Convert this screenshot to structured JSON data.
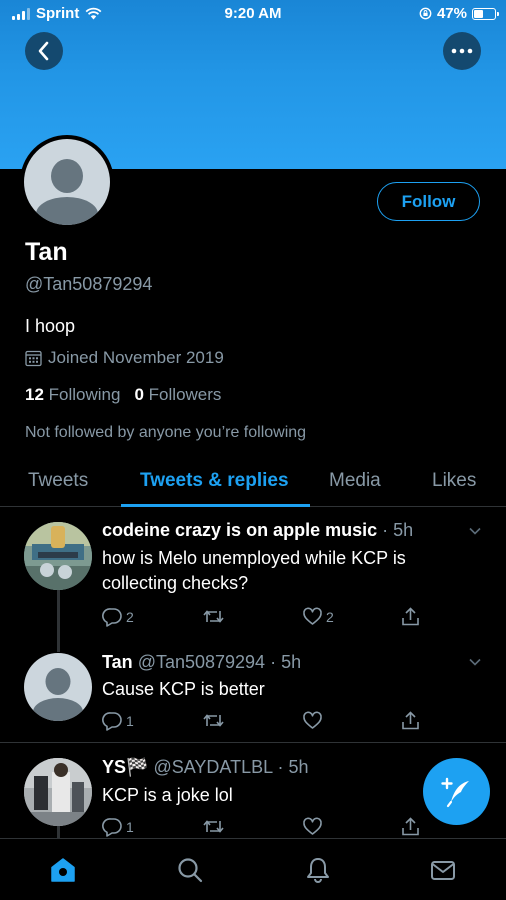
{
  "status_bar": {
    "carrier": "Sprint",
    "time": "9:20 AM",
    "battery": "47%",
    "battery_level": 0.47
  },
  "header": {
    "back_icon": "chevron-left-icon",
    "more_icon": "more-horizontal-icon"
  },
  "profile": {
    "name": "Tan",
    "handle": "@Tan50879294",
    "bio": "I hoop",
    "joined": "Joined November 2019",
    "following_count": "12",
    "following_label": "Following",
    "followers_count": "0",
    "followers_label": "Followers",
    "not_followed_text": "Not followed by anyone you’re following",
    "follow_button": "Follow"
  },
  "tabs": [
    {
      "label": "Tweets",
      "active": false
    },
    {
      "label": "Tweets & replies",
      "active": true
    },
    {
      "label": "Media",
      "active": false
    },
    {
      "label": "Likes",
      "active": false
    }
  ],
  "tweets": [
    {
      "name": "codeine crazy is on apple music",
      "handle": "",
      "time": "· 5h",
      "text": "how is Melo unemployed while KCP is collecting checks?",
      "replies": "2",
      "retweets": "",
      "likes": "2"
    },
    {
      "name": "Tan",
      "handle": "@Tan50879294",
      "time": "· 5h",
      "text": "Cause KCP is better",
      "replies": "1",
      "retweets": "",
      "likes": ""
    },
    {
      "name": "YS🏁",
      "handle": "@SAYDATLBL",
      "time": "· 5h",
      "text": "KCP is a joke lol",
      "replies": "1",
      "retweets": "",
      "likes": ""
    }
  ],
  "colors": {
    "accent": "#1da1f2",
    "background": "#000000",
    "secondary_text": "#8899a6",
    "banner": "#2296e6"
  },
  "bottom_nav": [
    "home-icon",
    "search-icon",
    "notifications-icon",
    "messages-icon"
  ]
}
